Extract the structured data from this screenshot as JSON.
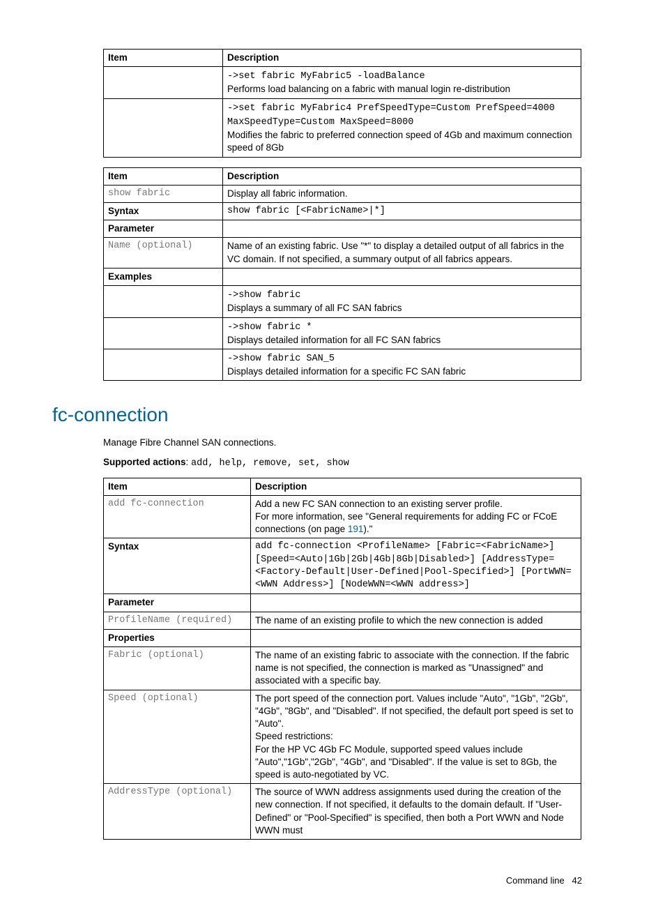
{
  "table1": {
    "head": {
      "item": "Item",
      "desc": "Description"
    },
    "rows": [
      {
        "item": "",
        "code": "->set fabric MyFabric5 -loadBalance",
        "text": "Performs load balancing on a fabric with manual login re-distribution"
      },
      {
        "item": "",
        "code": "->set fabric MyFabric4 PrefSpeedType=Custom PrefSpeed=4000 MaxSpeedType=Custom MaxSpeed=8000",
        "text": "Modifies the fabric to preferred connection speed of 4Gb and maximum connection speed of 8Gb"
      }
    ]
  },
  "table2": {
    "head": {
      "item": "Item",
      "desc": "Description"
    },
    "rows": [
      {
        "item_mono": "show fabric",
        "text": "Display all fabric information."
      },
      {
        "item_bold": "Syntax",
        "code_only": "show fabric [<FabricName>|*]"
      },
      {
        "item_bold": "Parameter",
        "text": ""
      },
      {
        "item_mono": "Name (optional)",
        "text": "Name of an existing fabric. Use \"*\" to display a detailed output of all fabrics in the VC domain. If not specified, a summary output of all fabrics appears."
      },
      {
        "item_bold": "Examples",
        "text": ""
      },
      {
        "item": "",
        "code": "->show fabric",
        "text": "Displays a summary of all FC SAN fabrics"
      },
      {
        "item": "",
        "code": "->show fabric *",
        "text": "Displays detailed information for all FC SAN fabrics"
      },
      {
        "item": "",
        "code": "->show fabric SAN_5",
        "text": "Displays detailed information for a specific FC SAN fabric"
      }
    ]
  },
  "section": {
    "title": "fc-connection",
    "intro": "Manage Fibre Channel SAN connections.",
    "supported_label": "Supported actions",
    "supported_actions": "add, help, remove, set, show"
  },
  "table3": {
    "head": {
      "item": "Item",
      "desc": "Description"
    },
    "rows": [
      {
        "item_mono": "add fc-connection",
        "html": "Add a new FC SAN connection to an existing server profile.\nFor more information, see \"General requirements for adding FC or FCoE connections (on page {LINK191}).\""
      },
      {
        "item_bold": "Syntax",
        "code_only": "add fc-connection <ProfileName> [Fabric=<FabricName>] [Speed=<Auto|1Gb|2Gb|4Gb|8Gb|Disabled>] [AddressType=<Factory-Default|User-Defined|Pool-Specified>] [PortWWN=<WWN Address>] [NodeWWN=<WWN address>]"
      },
      {
        "item_bold": "Parameter",
        "text": ""
      },
      {
        "item_mono": "ProfileName (required)",
        "text": "The name of an existing profile to which the new connection is added"
      },
      {
        "item_bold": "Properties",
        "text": ""
      },
      {
        "item_mono": "Fabric (optional)",
        "text": "The name of an existing fabric to associate with the connection. If the fabric name is not specified, the connection is marked as \"Unassigned\" and associated with a specific bay."
      },
      {
        "item_mono": "Speed (optional)",
        "text": "The port speed of the connection port. Values include \"Auto\", \"1Gb\", \"2Gb\", \"4Gb\", \"8Gb\", and \"Disabled\". If not specified, the default port speed is set to \"Auto\".\nSpeed restrictions:\nFor the HP VC 4Gb FC Module, supported speed values include \"Auto\",\"1Gb\",\"2Gb\", \"4Gb\", and \"Disabled\". If the value is set to 8Gb, the speed is auto-negotiated by VC."
      },
      {
        "item_mono": "AddressType (optional)",
        "text": "The source of WWN address assignments used during the creation of the new connection. If not specified, it defaults to the domain default. If \"User-Defined\" or \"Pool-Specified\" is specified, then both a Port WWN and Node WWN must"
      }
    ]
  },
  "link191": "191",
  "footer": {
    "label": "Command line",
    "page": "42"
  }
}
